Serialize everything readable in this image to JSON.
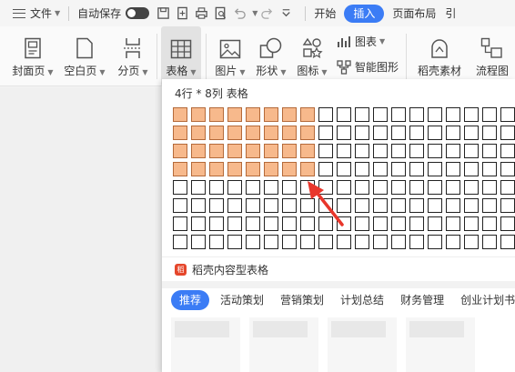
{
  "menubar": {
    "file_label": "文件",
    "autosave_label": "自动保存",
    "tabs": [
      "开始",
      "插入",
      "页面布局",
      "引"
    ],
    "active_tab": "插入"
  },
  "ribbon": {
    "cover_page": "封面页",
    "blank_page": "空白页",
    "page_break": "分页",
    "table": "表格",
    "picture": "图片",
    "shape": "形状",
    "icon": "图标",
    "chart": "图表",
    "smart_art": "智能图形",
    "daoke_material": "稻壳素材",
    "flowchart": "流程图"
  },
  "table_dropdown": {
    "caption": "4行 * 8列 表格",
    "rows": 8,
    "cols": 19,
    "selected_rows": 4,
    "selected_cols": 8,
    "ai_logo_text": "稻",
    "ai_label": "稻壳内容型表格",
    "categories": [
      "推荐",
      "活动策划",
      "营销策划",
      "计划总结",
      "财务管理",
      "创业计划书"
    ],
    "active_category": "推荐"
  },
  "colors": {
    "accent": "#3b7cf5",
    "cell_selected": "#f7b98c",
    "arrow": "#e8362b"
  }
}
